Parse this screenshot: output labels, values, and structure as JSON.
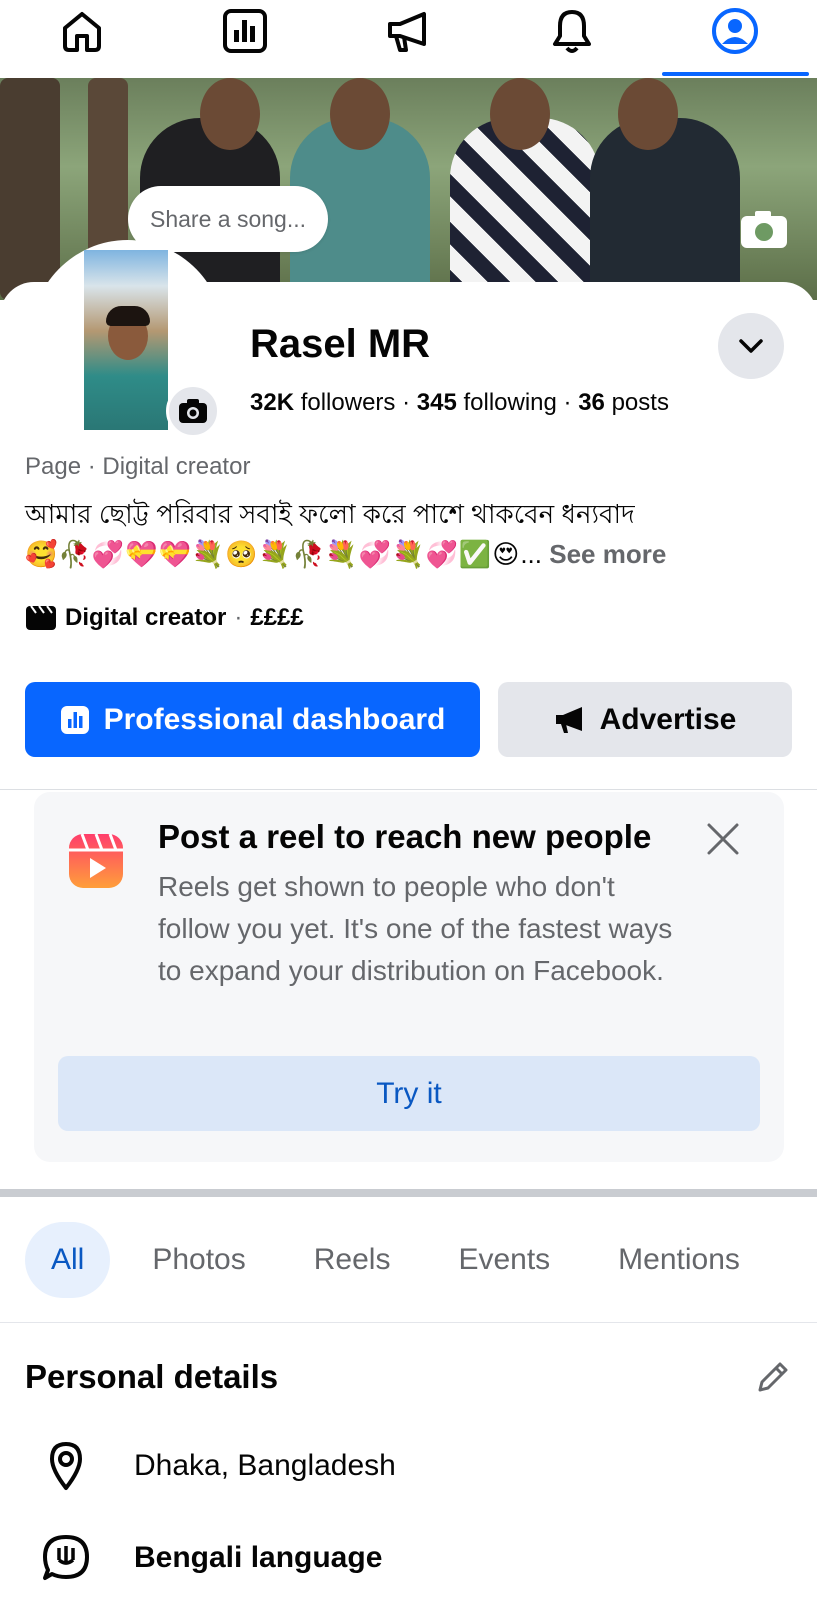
{
  "nav": {
    "tabs": [
      {
        "icon": "home-icon"
      },
      {
        "icon": "dashboard-icon"
      },
      {
        "icon": "megaphone-icon"
      },
      {
        "icon": "bell-icon"
      },
      {
        "icon": "profile-icon",
        "active": true
      }
    ]
  },
  "cover": {
    "song_prompt": "Share a song..."
  },
  "profile": {
    "name": "Rasel MR",
    "followers_count": "32K",
    "followers_label": "followers",
    "following_count": "345",
    "following_label": "following",
    "posts_count": "36",
    "posts_label": "posts",
    "category_line": "Page · Digital creator",
    "bio_text": "আমার ছোট্ট পরিবার সবাই ফলো করে পাশে থাকবেন ধন্যবাদ",
    "bio_emojis": "🥰🥀💞💝💝💐🥺💐🥀💐💞💐💞✅😍",
    "bio_ellipsis": "...",
    "see_more": "See more",
    "creator_label": "Digital creator",
    "creator_sep": "·",
    "price_range": "££££"
  },
  "actions": {
    "primary_label": "Professional dashboard",
    "secondary_label": "Advertise"
  },
  "promo": {
    "title": "Post a reel to reach new people",
    "body": "Reels get shown to people who don't follow you yet. It's one of the fastest ways to expand your distribution on Facebook.",
    "button": "Try it"
  },
  "filters": [
    "All",
    "Photos",
    "Reels",
    "Events",
    "Mentions"
  ],
  "personal_details": {
    "title": "Personal details",
    "location": "Dhaka, Bangladesh",
    "language": "Bengali language"
  },
  "colors": {
    "accent": "#0866ff",
    "secondary_text": "#65676b"
  }
}
